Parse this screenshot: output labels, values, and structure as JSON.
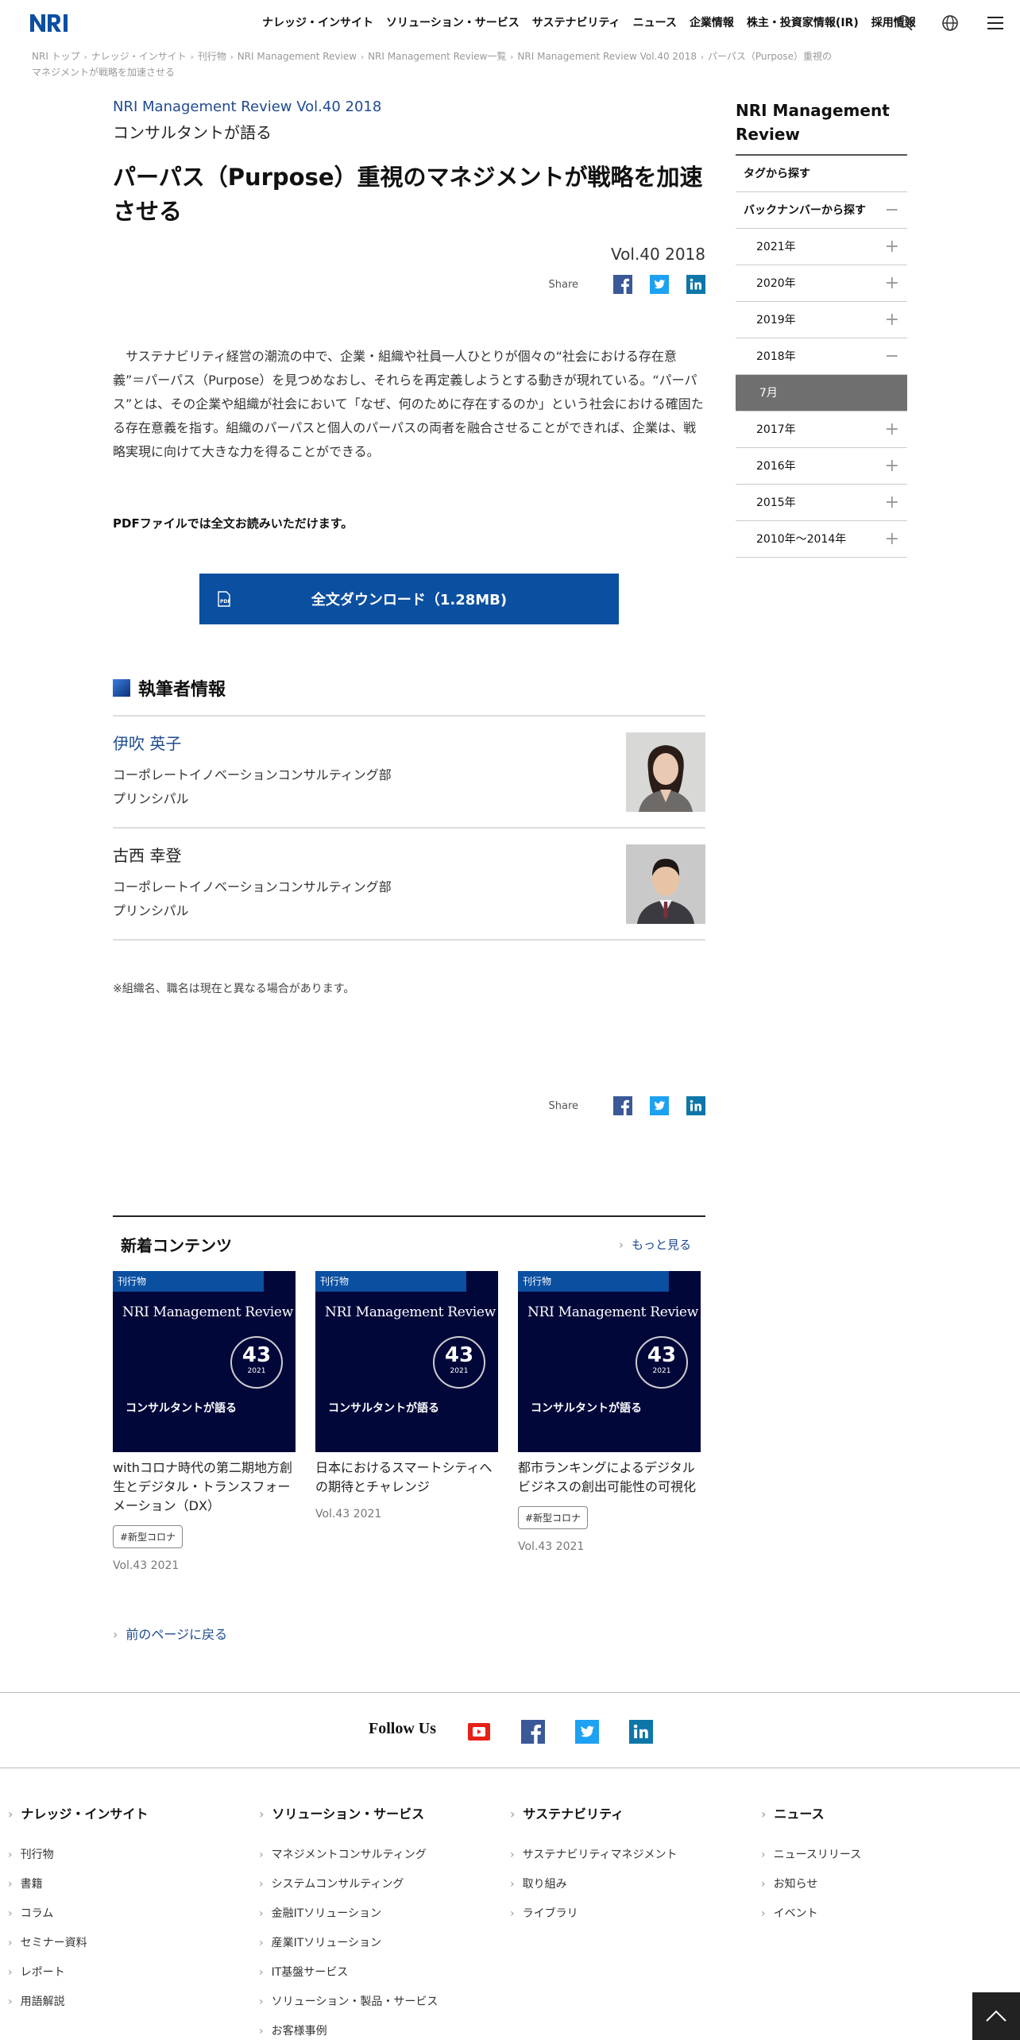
{
  "header": {
    "nav": [
      "ナレッジ・インサイト",
      "ソリューション・サービス",
      "サステナビリティ",
      "ニュース",
      "企業情報",
      "株主・投資家情報(IR)",
      "採用情報"
    ]
  },
  "breadcrumb": [
    "NRI トップ",
    "ナレッジ・インサイト",
    "刊行物",
    "NRI Management Review",
    "NRI Management Review一覧",
    "NRI Management Review Vol.40 2018",
    "パーパス（Purpose）重視のマネジメントが戦略を加速させる"
  ],
  "article": {
    "kicker": "NRI Management Review Vol.40 2018",
    "series": "コンサルタントが語る",
    "title": "パーパス（Purpose）重視のマネジメントが戦略を加速させる",
    "vol": "Vol.40 2018",
    "share_label": "Share",
    "lead": "　サステナビリティ経営の潮流の中で、企業・組織や社員一人ひとりが個々の“社会における存在意義”＝パーパス（Purpose）を見つめなおし、それらを再定義しようとする動きが現れている。“パーパス”とは、その企業や組織が社会において「なぜ、何のために存在するのか」という社会における確固たる存在意義を指す。組織のパーパスと個人のパーパスの両者を融合させることができれば、企業は、戦略実現に向けて大きな力を得ることができる。",
    "pdf_note": "PDFファイルでは全文お読みいただけます。",
    "download_label": "全文ダウンロード（1.28MB)",
    "authors_heading": "執筆者情報",
    "authors": [
      {
        "name": "伊吹 英子",
        "dept": "コーポレートイノベーションコンサルティング部",
        "role": "プリンシパル"
      },
      {
        "name": "古西 幸登",
        "dept": "コーポレートイノベーションコンサルティング部",
        "role": "プリンシパル"
      }
    ],
    "note": "※組織名、職名は現在と異なる場合があります。"
  },
  "new_contents": {
    "heading": "新着コンテンツ",
    "more": "もっと見る",
    "cards": [
      {
        "tag": "刊行物",
        "brand": "NRI Management Review",
        "num": "43",
        "year": "2021",
        "sub": "コンサルタントが語る",
        "title": "withコロナ時代の第二期地方創生とデジタル・トランスフォーメーション（DX）",
        "badge": "#新型コロナ",
        "vol": "Vol.43 2021"
      },
      {
        "tag": "刊行物",
        "brand": "NRI Management Review",
        "num": "43",
        "year": "2021",
        "sub": "コンサルタントが語る",
        "title": "日本におけるスマートシティへの期待とチャレンジ",
        "badge": "",
        "vol": "Vol.43 2021"
      },
      {
        "tag": "刊行物",
        "brand": "NRI Management Review",
        "num": "43",
        "year": "2021",
        "sub": "コンサルタントが語る",
        "title": "都市ランキングによるデジタルビジネスの創出可能性の可視化",
        "badge": "#新型コロナ",
        "vol": "Vol.43 2021"
      }
    ],
    "back": "前のページに戻る"
  },
  "sidebar": {
    "title": "NRI Management Review",
    "tags": "タグから探す",
    "backnumber": "バックナンバーから探す",
    "years": [
      "2021年",
      "2020年",
      "2019年",
      "2018年",
      "2017年",
      "2016年",
      "2015年",
      "2010年～2014年"
    ],
    "month": "7月"
  },
  "follow": {
    "label": "Follow Us"
  },
  "footer": {
    "cols": [
      {
        "h": "ナレッジ・インサイト",
        "items": [
          "刊行物",
          "書籍",
          "コラム",
          "セミナー資料",
          "レポート",
          "用語解説"
        ]
      },
      {
        "h": "ソリューション・サービス",
        "items": [
          "マネジメントコンサルティング",
          "システムコンサルティング",
          "金融ITソリューション",
          "産業ITソリューション",
          "IT基盤サービス",
          "ソリューション・製品・サービス",
          "お客様事例"
        ]
      },
      {
        "h": "サステナビリティ",
        "items": [
          "サステナビリティマネジメント",
          "取り組み",
          "ライブラリ"
        ]
      },
      {
        "h": "ニュース",
        "items": [
          "ニュースリリース",
          "お知らせ",
          "イベント"
        ]
      }
    ]
  },
  "colors": {
    "brand_blue": "#0b4fa1",
    "link_blue": "#1f4b8f",
    "navy": "#02073a"
  }
}
